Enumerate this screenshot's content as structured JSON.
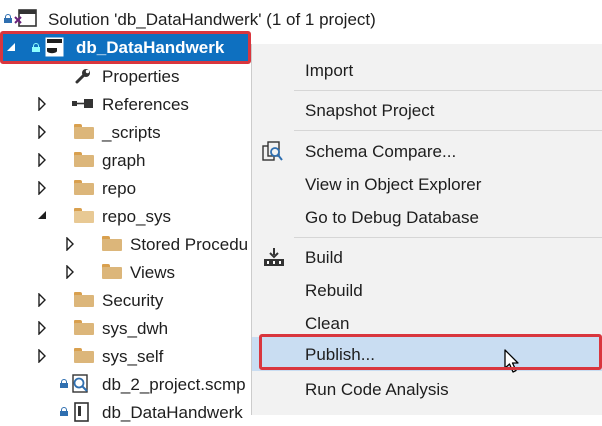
{
  "solution": {
    "title": "Solution 'db_DataHandwerk' (1 of 1 project)"
  },
  "project": {
    "name": "db_DataHandwerk"
  },
  "tree": {
    "properties": "Properties",
    "references": "References",
    "scripts": "_scripts",
    "graph": "graph",
    "repo": "repo",
    "repo_sys": "repo_sys",
    "stored_procedures": "Stored Procedu",
    "views": "Views",
    "security": "Security",
    "sys_dwh": "sys_dwh",
    "sys_self": "sys_self",
    "schema_compare_file": "db_2_project.scmp",
    "project_file": "db_DataHandwerk"
  },
  "menu": {
    "import": "Import",
    "snapshot": "Snapshot Project",
    "schema_compare": "Schema Compare...",
    "view_in_object_explorer": "View in Object Explorer",
    "go_to_debug_db": "Go to Debug Database",
    "build": "Build",
    "rebuild": "Rebuild",
    "clean": "Clean",
    "publish": "Publish...",
    "run_code_analysis": "Run Code Analysis"
  },
  "colors": {
    "selection": "#0e70c0",
    "highlight": "#c9ddf2",
    "annotation": "#d9363e"
  }
}
